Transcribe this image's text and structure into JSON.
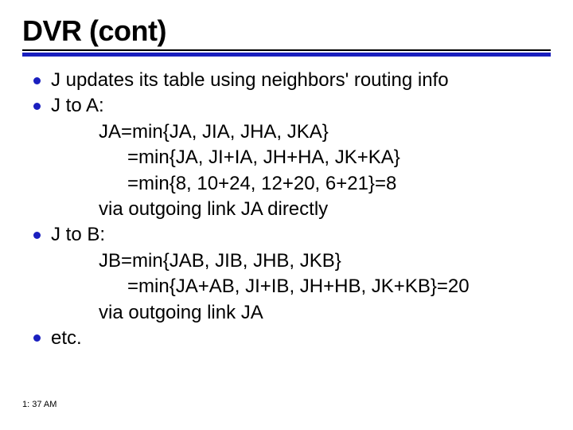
{
  "slide": {
    "title": "DVR (cont)",
    "bullets": {
      "b1": "J updates its table using neighbors' routing info",
      "b2": "J to A:",
      "b2_lines": {
        "l1": "JA=min{JA, JIA, JHA, JKA}",
        "l2": "=min{JA, JI+IA, JH+HA, JK+KA}",
        "l3": "=min{8, 10+24, 12+20, 6+21}=8",
        "l4": "via outgoing link JA directly"
      },
      "b3": "J to B:",
      "b3_lines": {
        "l1": "JB=min{JAB, JIB, JHB, JKB}",
        "l2": "=min{JA+AB, JI+IB, JH+HB, JK+KB}=20",
        "l3": "via outgoing link JA"
      },
      "b4": "etc."
    },
    "timestamp": "1: 37 AM"
  }
}
